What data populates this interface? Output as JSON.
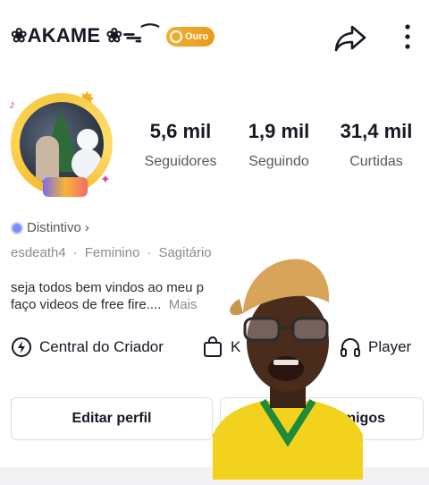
{
  "header": {
    "username": "❀AKAME ❀ᯓ⁀",
    "badge_label": "Ouro"
  },
  "stats": [
    {
      "value": "5,6 mil",
      "label": "Seguidores"
    },
    {
      "value": "1,9 mil",
      "label": "Seguindo"
    },
    {
      "value": "31,4 mil",
      "label": "Curtidas"
    }
  ],
  "profile": {
    "distintivo": "Distintivo",
    "distintivo_chevron": "›",
    "handle": "esdeath4",
    "gender": "Feminino",
    "sign": "Sagitário",
    "bio_line1": "seja todos bem vindos ao meu p",
    "bio_line2": "faço videos de free fire....",
    "bio_more": "Mais"
  },
  "tools": {
    "creator_center": "Central do Criador",
    "shop": "K",
    "player": "Player"
  },
  "buttons": {
    "edit_profile": "Editar perfil",
    "friends": "migos"
  },
  "colors": {
    "badge": "#e89a1a",
    "text": "#161823",
    "secondary": "#57585e"
  }
}
